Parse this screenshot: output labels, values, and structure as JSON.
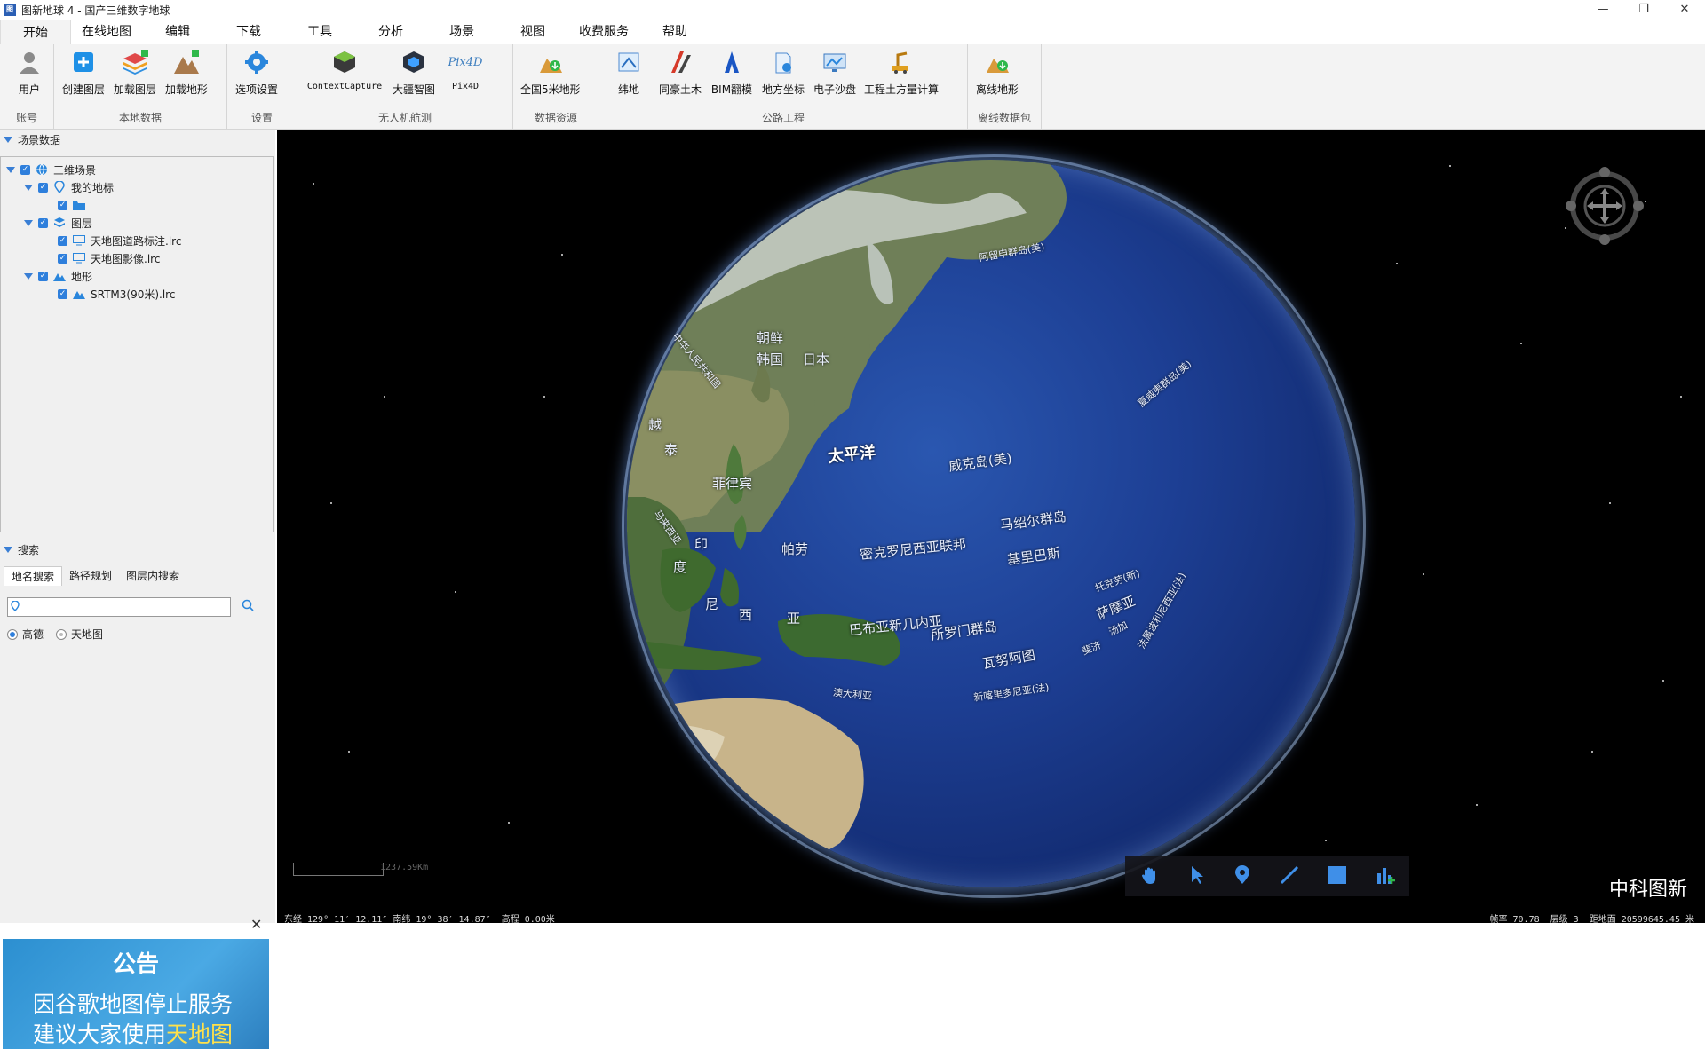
{
  "window": {
    "title": "图新地球 4 - 国产三维数字地球",
    "icon_text": "图"
  },
  "menu": [
    "开始",
    "在线地图",
    "编辑",
    "下载",
    "工具",
    "分析",
    "场景",
    "视图",
    "收费服务",
    "帮助"
  ],
  "ribbon": {
    "groups": [
      {
        "label": "账号",
        "buttons": [
          "用户"
        ]
      },
      {
        "label": "本地数据",
        "buttons": [
          "创建图层",
          "加载图层",
          "加载地形"
        ]
      },
      {
        "label": "设置",
        "buttons": [
          "选项设置"
        ]
      },
      {
        "label": "无人机航测",
        "buttons": [
          "ContextCapture",
          "大疆智图",
          "Pix4D"
        ]
      },
      {
        "label": "数据资源",
        "buttons": [
          "全国5米地形"
        ]
      },
      {
        "label": "公路工程",
        "buttons": [
          "纬地",
          "同豪土木",
          "BIM翻模",
          "地方坐标",
          "电子沙盘",
          "工程土方量计算"
        ]
      },
      {
        "label": "离线数据包",
        "buttons": [
          "离线地形"
        ]
      }
    ],
    "pix4d_icon_text": "Pix4D"
  },
  "scene_panel": {
    "title": "场景数据",
    "tree": [
      {
        "label": "三维场景"
      },
      {
        "label": "我的地标"
      },
      {
        "label": ""
      },
      {
        "label": "图层"
      },
      {
        "label": "天地图道路标注.lrc"
      },
      {
        "label": "天地图影像.lrc"
      },
      {
        "label": "地形"
      },
      {
        "label": "SRTM3(90米).lrc"
      }
    ]
  },
  "search_panel": {
    "title": "搜索",
    "tabs": [
      "地名搜索",
      "路径规划",
      "图层内搜索"
    ],
    "input_value": "",
    "radios": [
      {
        "label": "高德",
        "checked": true
      },
      {
        "label": "天地图",
        "checked": false
      }
    ]
  },
  "notice": {
    "close": "✕",
    "title": "公告",
    "line1": "因谷歌地图停止服务",
    "line2_prefix": "建议大家使用",
    "line2_highlight": "天地图"
  },
  "globe_labels": {
    "arctic": "阿留申群岛(美)",
    "korea_n": "朝鲜",
    "korea_s": "韩国",
    "japan": "日本",
    "china": "中华人民共和国",
    "hawaii": "夏威夷群岛(美)",
    "pacific": "太平洋",
    "wake": "威克岛(美)",
    "philippines": "菲律宾",
    "palau": "帕劳",
    "micronesia": "密克罗尼西亚联邦",
    "marshall": "马绍尔群岛",
    "kiribati": "基里巴斯",
    "malaysia": "马来西亚",
    "indo1": "印",
    "indo2": "度",
    "indo3": "尼",
    "indo4": "西",
    "indo5": "亚",
    "viet": "越",
    "thai": "泰",
    "png": "巴布亚新几内亚",
    "solomon": "所罗门群岛",
    "vanuatu": "瓦努阿图",
    "tokelau": "托克劳(新)",
    "samoa": "萨摩亚",
    "tonga": "汤加",
    "fiji": "斐济",
    "polynesia": "法属波利尼西亚(法)",
    "newcal": "新喀里多尼亚(法)",
    "aus": "澳大利亚"
  },
  "scale_label": "1237.59Km",
  "brand": "中科图新",
  "status": {
    "left": "东经 129° 11′ 12.11″ 南纬 19° 38′ 14.87″  高程 0.00米",
    "right": "帧率 70.78  层级 3  距地面 20599645.45 米"
  }
}
